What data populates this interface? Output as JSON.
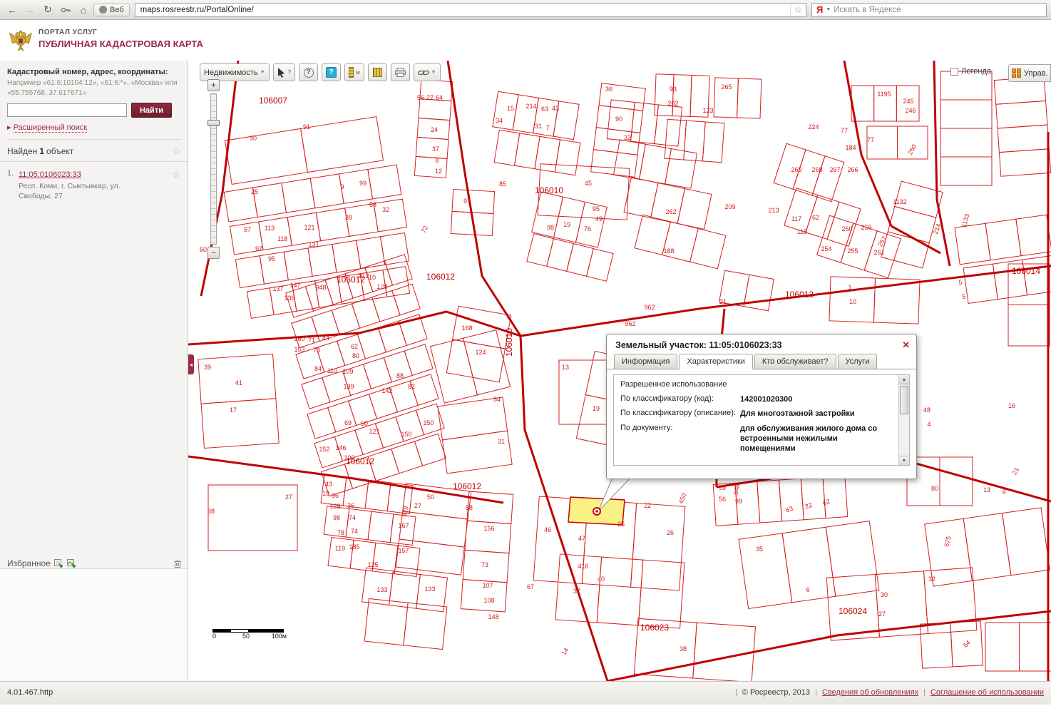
{
  "icons": {
    "back": "←",
    "forward": "→",
    "refresh": "↻",
    "home": "⌂",
    "star": "☆",
    "dropdown": "▼",
    "close": "✕",
    "adv_arrow": "▸",
    "collapse": "◂",
    "scroll_up": "▲",
    "scroll_down": "▼"
  },
  "browser": {
    "web_button": "Веб",
    "url": "maps.rosreestr.ru/PortalOnline/",
    "yandex_logo": "Я",
    "search_placeholder": "Искать в Яндексе"
  },
  "header": {
    "portal_line1": "ПОРТАЛ УСЛУГ",
    "portal_line2": "ПУБЛИЧНАЯ КАДАСТРОВАЯ КАРТА"
  },
  "sidebar": {
    "search_label": "Кадастровый номер, адрес, координаты:",
    "search_hint": "Например «61:6:10104:12», «61:6:*», «Москва» или «55.755768, 37.617671»",
    "find_button": "Найти",
    "advanced_search": "Расширенный поиск",
    "results_prefix": "Найден",
    "results_count": "1",
    "results_suffix": "объект",
    "result": {
      "index": "1.",
      "cadastral_number": "11:05:0106023:33",
      "address": "Респ. Коми, г. Сыктывкар, ул. Свободы, 27"
    },
    "favorites_label": "Избранное"
  },
  "map_toolbar": {
    "layer_select": "Недвижимость",
    "legend_label": "Легенда",
    "manage_label": "Управ."
  },
  "map_controls": {
    "zoom_in": "+",
    "zoom_out": "−"
  },
  "map": {
    "scale": {
      "start": "0",
      "mid": "50",
      "end": "100м"
    },
    "quarter_labels": [
      [
        "106007",
        119,
        60
      ],
      [
        "106010",
        506,
        186
      ],
      [
        "106010",
        454,
        395,
        -90
      ],
      [
        "106012",
        228,
        311
      ],
      [
        "106012",
        354,
        307
      ],
      [
        "106012",
        241,
        566
      ],
      [
        "106012",
        391,
        601
      ],
      [
        "106013",
        857,
        332
      ],
      [
        "106014",
        1175,
        299
      ],
      [
        "106023",
        654,
        799
      ],
      [
        "106024",
        932,
        776
      ]
    ],
    "parcel_labels": [
      [
        "90",
        91,
        112
      ],
      [
        "91",
        166,
        96
      ],
      [
        "25",
        93,
        187
      ],
      [
        "57",
        83,
        240
      ],
      [
        "113",
        114,
        238
      ],
      [
        "121",
        170,
        237
      ],
      [
        "97",
        99,
        267
      ],
      [
        "95",
        117,
        281
      ],
      [
        "118",
        132,
        253
      ],
      [
        "131",
        176,
        261
      ],
      [
        "39",
        225,
        223
      ],
      [
        "68",
        259,
        205
      ],
      [
        "32",
        277,
        212
      ],
      [
        "9",
        216,
        180
      ],
      [
        "99",
        245,
        175
      ],
      [
        "137",
        126,
        323
      ],
      [
        "147",
        150,
        318
      ],
      [
        "136",
        142,
        336
      ],
      [
        "948",
        186,
        321
      ],
      [
        "160",
        156,
        393
      ],
      [
        "71",
        173,
        395
      ],
      [
        "44",
        193,
        392
      ],
      [
        "153",
        156,
        408
      ],
      [
        "73",
        180,
        409
      ],
      [
        "62",
        233,
        404
      ],
      [
        "80",
        235,
        417
      ],
      [
        "84",
        182,
        435
      ],
      [
        "110",
        202,
        438
      ],
      [
        "109",
        224,
        439
      ],
      [
        "139",
        225,
        460
      ],
      [
        "142",
        279,
        466
      ],
      [
        "88",
        297,
        445
      ],
      [
        "82",
        313,
        460
      ],
      [
        "17",
        63,
        493
      ],
      [
        "41",
        71,
        455
      ],
      [
        "39",
        27,
        433
      ],
      [
        "69",
        224,
        511
      ],
      [
        "60",
        247,
        512
      ],
      [
        "121",
        261,
        523
      ],
      [
        "150",
        306,
        527
      ],
      [
        "150",
        337,
        511
      ],
      [
        "152",
        191,
        548
      ],
      [
        "146",
        214,
        546
      ],
      [
        "100",
        226,
        560
      ],
      [
        "24",
        345,
        100
      ],
      [
        "37",
        347,
        127
      ],
      [
        "8",
        349,
        143
      ],
      [
        "12",
        351,
        158
      ],
      [
        "56",
        326,
        55
      ],
      [
        "27",
        339,
        55
      ],
      [
        "64",
        352,
        55
      ],
      [
        "85",
        441,
        176
      ],
      [
        "97",
        391,
        200
      ],
      [
        "34",
        436,
        87
      ],
      [
        "15",
        452,
        70
      ],
      [
        "214",
        481,
        67
      ],
      [
        "63",
        500,
        71
      ],
      [
        "43",
        515,
        70
      ],
      [
        "7",
        504,
        97
      ],
      [
        "31",
        491,
        95
      ],
      [
        "90",
        604,
        85
      ],
      [
        "32",
        616,
        111
      ],
      [
        "45",
        561,
        175
      ],
      [
        "95",
        572,
        211
      ],
      [
        "49",
        576,
        225
      ],
      [
        "76",
        560,
        239
      ],
      [
        "19",
        531,
        233
      ],
      [
        "98",
        508,
        237
      ],
      [
        "912",
        246,
        305
      ],
      [
        "10",
        258,
        307
      ],
      [
        "129",
        272,
        320
      ],
      [
        "72",
        334,
        238,
        -60
      ],
      [
        "168",
        391,
        378
      ],
      [
        "124",
        410,
        412
      ],
      [
        "54",
        433,
        478
      ],
      [
        "31",
        439,
        537
      ],
      [
        "13",
        529,
        433
      ],
      [
        "19",
        572,
        491
      ],
      [
        "962",
        647,
        349
      ],
      [
        "962",
        620,
        372
      ],
      [
        "36",
        590,
        43
      ],
      [
        "93",
        680,
        43
      ],
      [
        "202",
        680,
        63
      ],
      [
        "123",
        729,
        73
      ],
      [
        "265",
        755,
        40
      ],
      [
        "262",
        677,
        215
      ],
      [
        "188",
        674,
        270
      ],
      [
        "209",
        760,
        208
      ],
      [
        "213",
        821,
        213
      ],
      [
        "117",
        853,
        225
      ],
      [
        "62",
        880,
        223
      ],
      [
        "118",
        861,
        243
      ],
      [
        "269",
        853,
        156
      ],
      [
        "268",
        882,
        156
      ],
      [
        "267",
        907,
        156
      ],
      [
        "266",
        932,
        156
      ],
      [
        "260",
        924,
        239
      ],
      [
        "259",
        951,
        237
      ],
      [
        "257",
        976,
        255,
        -60
      ],
      [
        "254",
        895,
        267
      ],
      [
        "255",
        932,
        270
      ],
      [
        "261",
        969,
        272
      ],
      [
        "1132",
        998,
        201
      ],
      [
        "1133",
        1093,
        225,
        -75
      ],
      [
        "214",
        1053,
        237,
        -70
      ],
      [
        "250",
        1018,
        126,
        -60
      ],
      [
        "245",
        1010,
        60
      ],
      [
        "246",
        1013,
        73
      ],
      [
        "1195",
        976,
        50
      ],
      [
        "224",
        877,
        96
      ],
      [
        "77",
        920,
        101
      ],
      [
        "184",
        929,
        125
      ],
      [
        "77",
        957,
        114
      ],
      [
        "21",
        750,
        341
      ],
      [
        "1",
        928,
        321
      ],
      [
        "10",
        932,
        341
      ],
      [
        "5",
        1083,
        314
      ],
      [
        "5",
        1088,
        334
      ],
      [
        "16",
        1155,
        487
      ],
      [
        "48",
        1036,
        493
      ],
      [
        "4",
        1039,
        513
      ],
      [
        "38",
        32,
        635
      ],
      [
        "27",
        141,
        615
      ],
      [
        "43",
        197,
        597
      ],
      [
        "18",
        193,
        610
      ],
      [
        "96",
        206,
        613
      ],
      [
        "128",
        206,
        628
      ],
      [
        "36",
        228,
        627
      ],
      [
        "98",
        208,
        644
      ],
      [
        "74",
        230,
        644
      ],
      [
        "78",
        214,
        665
      ],
      [
        "74",
        233,
        663
      ],
      [
        "119",
        213,
        687
      ],
      [
        "185",
        233,
        685
      ],
      [
        "125",
        259,
        710
      ],
      [
        "133",
        272,
        745
      ],
      [
        "157",
        302,
        690
      ],
      [
        "167",
        302,
        655
      ],
      [
        "27",
        322,
        627
      ],
      [
        "50",
        340,
        615
      ],
      [
        "58",
        394,
        630
      ],
      [
        "156",
        422,
        659
      ],
      [
        "73",
        416,
        710
      ],
      [
        "107",
        420,
        739
      ],
      [
        "108",
        422,
        760
      ],
      [
        "148",
        428,
        783
      ],
      [
        "67",
        480,
        741
      ],
      [
        "37",
        545,
        747
      ],
      [
        "133",
        339,
        744
      ],
      [
        "929",
        307,
        633,
        -75
      ],
      [
        "46",
        504,
        661
      ],
      [
        "47",
        552,
        673
      ],
      [
        "416",
        554,
        712
      ],
      [
        "40",
        579,
        730
      ],
      [
        "35",
        607,
        653
      ],
      [
        "22",
        644,
        627
      ],
      [
        "26",
        676,
        665
      ],
      [
        "450",
        696,
        615,
        -70
      ],
      [
        "38",
        694,
        828
      ],
      [
        "14",
        531,
        830,
        -60
      ],
      [
        "59",
        749,
        602
      ],
      [
        "648",
        772,
        602,
        -80
      ],
      [
        "56",
        749,
        618
      ],
      [
        "99",
        772,
        621
      ],
      [
        "63",
        844,
        632,
        -20
      ],
      [
        "22",
        871,
        627,
        -20
      ],
      [
        "62",
        896,
        622,
        -20
      ],
      [
        "35",
        801,
        688
      ],
      [
        "6",
        869,
        745
      ],
      [
        "30",
        976,
        752
      ],
      [
        "32",
        1043,
        730
      ],
      [
        "27",
        973,
        779
      ],
      [
        "80",
        1047,
        603
      ],
      [
        "13",
        1120,
        605
      ],
      [
        "9",
        1144,
        608
      ],
      [
        "675",
        1068,
        675,
        -75
      ],
      [
        "21",
        1163,
        577,
        -60
      ],
      [
        "64",
        1094,
        820,
        -45
      ],
      [
        "60",
        21,
        268
      ]
    ]
  },
  "popup": {
    "title": "Земельный участок: 11:05:0106023:33",
    "tabs": [
      "Информация",
      "Характеристики",
      "Кто обслуживает?",
      "Услуги"
    ],
    "active_tab": "Характеристики",
    "section_title": "Разрешенное использование",
    "rows": [
      {
        "label": "По классификатору (код):",
        "value": "142001020300"
      },
      {
        "label": "По классификатору (описание):",
        "value": "Для многоэтажной застройки"
      },
      {
        "label": "По документу:",
        "value": "для обслуживания жилого дома со встроенными нежилыми помещениями"
      }
    ]
  },
  "footer": {
    "version": "4.01.467.http",
    "copyright": "© Росреестр, 2013",
    "link_updates": "Сведения об обновлениях",
    "link_agreement": "Соглашение об использовании"
  }
}
